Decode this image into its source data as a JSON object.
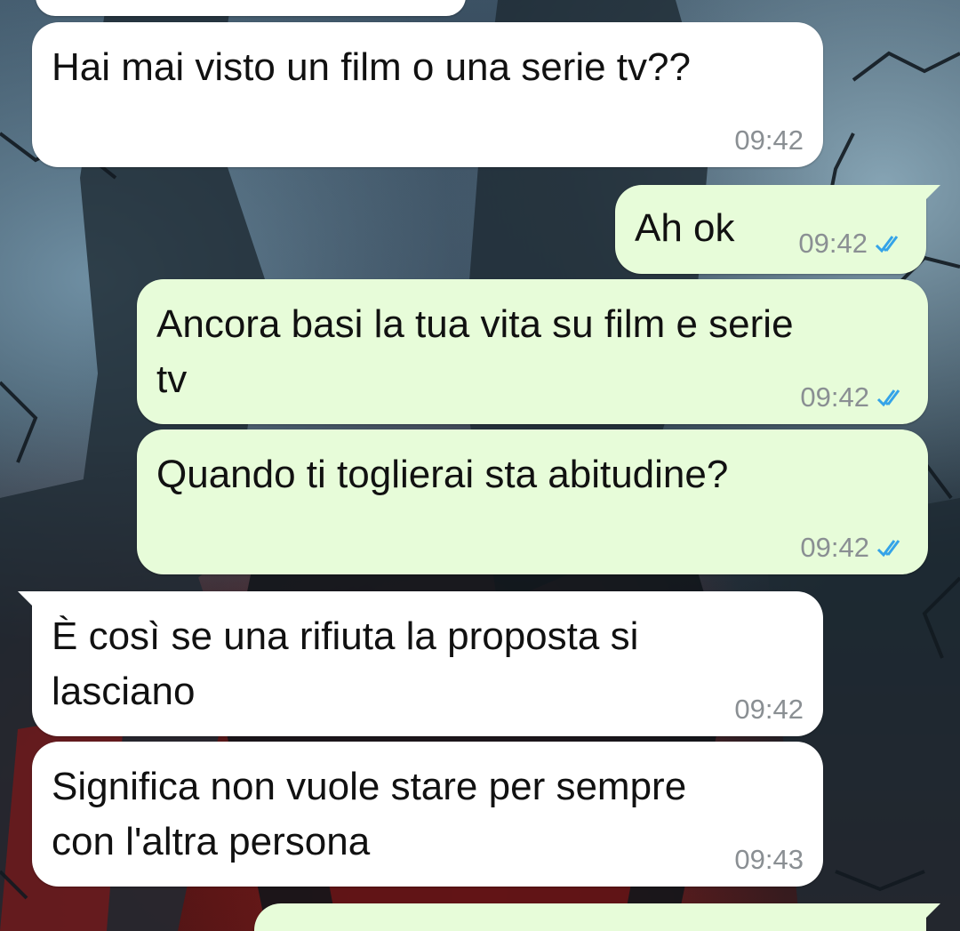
{
  "messages": [
    {
      "direction": "incoming",
      "text": "Hai mai visto un film o una serie tv??",
      "time": "09:42"
    },
    {
      "direction": "outgoing",
      "text": "Ah ok",
      "time": "09:42",
      "read_receipt": "double-check-icon"
    },
    {
      "direction": "outgoing",
      "text": "Ancora basi la tua vita su film e serie\ntv",
      "time": "09:42",
      "read_receipt": "double-check-icon"
    },
    {
      "direction": "outgoing",
      "text": "Quando ti toglierai sta abitudine?",
      "time": "09:42",
      "read_receipt": "double-check-icon"
    },
    {
      "direction": "incoming",
      "text": "È così se una rifiuta la proposta si\nlasciano",
      "time": "09:42"
    },
    {
      "direction": "incoming",
      "text": "Significa non vuole stare per sempre\ncon l'altra persona",
      "time": "09:43"
    }
  ],
  "colors": {
    "incoming_bubble": "#ffffff",
    "outgoing_bubble": "#e7fcd9",
    "timestamp": "#8a8f93",
    "read_tick": "#34a3e8"
  }
}
